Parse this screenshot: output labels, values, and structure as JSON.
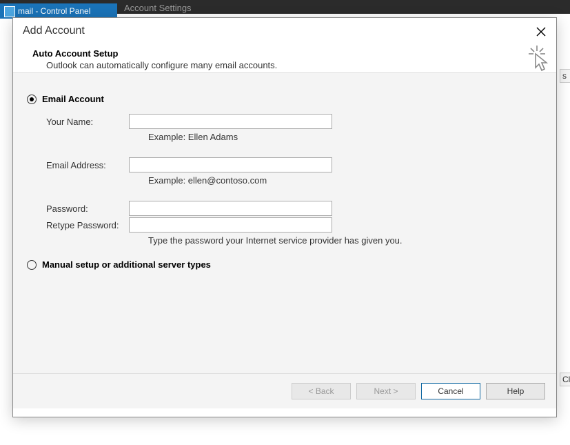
{
  "background": {
    "ctrl_panel_tab": "mail - Control Panel",
    "bg_label": "Account Settings",
    "right_frag_1": "s",
    "right_frag_2": "Cl"
  },
  "dialog": {
    "title": "Add Account",
    "section_title": "Auto Account Setup",
    "section_desc": "Outlook can automatically configure many email accounts.",
    "options": {
      "email_account": "Email Account",
      "manual_setup": "Manual setup or additional server types"
    },
    "fields": {
      "your_name_label": "Your Name:",
      "your_name_value": "",
      "your_name_hint": "Example: Ellen Adams",
      "email_label": "Email Address:",
      "email_value": "",
      "email_hint": "Example: ellen@contoso.com",
      "password_label": "Password:",
      "password_value": "",
      "retype_password_label": "Retype Password:",
      "retype_password_value": "",
      "password_hint": "Type the password your Internet service provider has given you."
    },
    "buttons": {
      "back": "< Back",
      "next": "Next >",
      "cancel": "Cancel",
      "help": "Help"
    }
  }
}
